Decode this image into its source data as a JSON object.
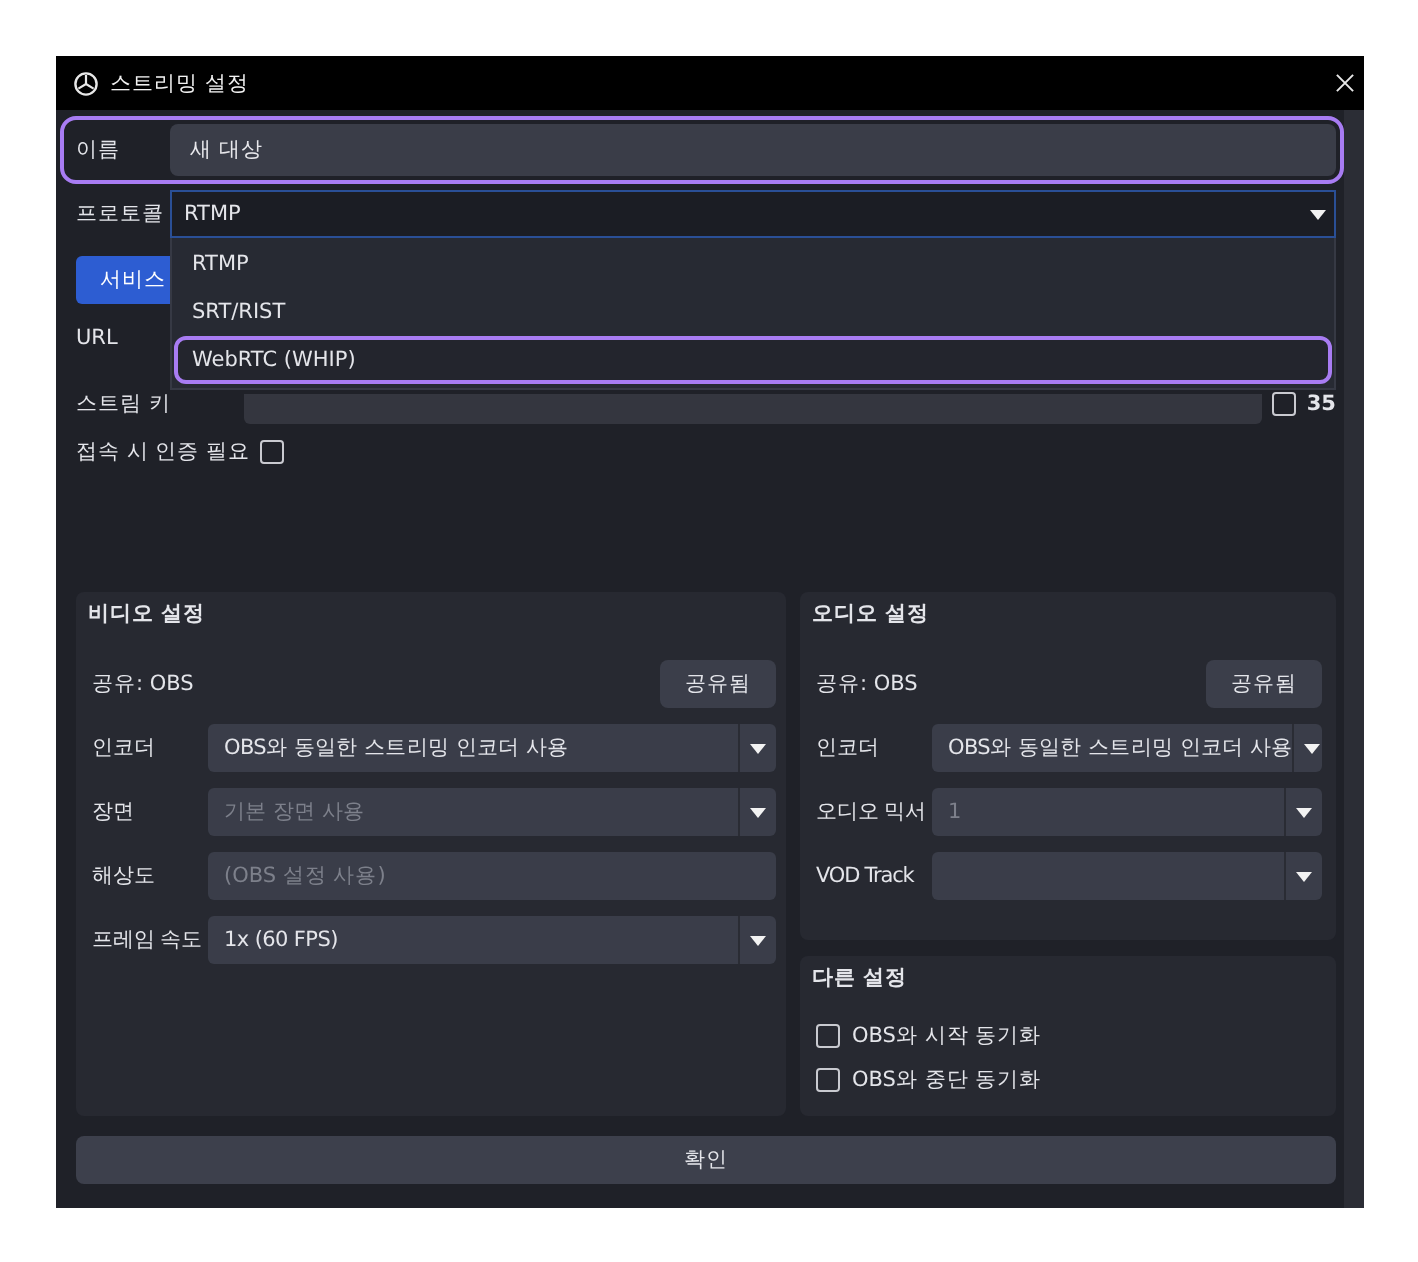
{
  "window": {
    "title": "스트리밍 설정"
  },
  "name_field": {
    "label": "이름",
    "value": "새 대상",
    "highlighted": true
  },
  "protocol": {
    "label": "프로토콜",
    "value": "RTMP",
    "expanded": true,
    "options": [
      {
        "label": "RTMP",
        "highlighted": false
      },
      {
        "label": "SRT/RIST",
        "highlighted": false
      },
      {
        "label": "WebRTC (WHIP)",
        "highlighted": true
      }
    ]
  },
  "service_button": {
    "label": "서비스"
  },
  "url": {
    "label": "URL"
  },
  "stream_key": {
    "label": "스트림 키",
    "checked": false,
    "checkbox_label": "35"
  },
  "auth": {
    "label": "접속 시 인증 필요",
    "checked": false
  },
  "video_settings": {
    "title": "비디오 설정",
    "shared_label": "공유: OBS",
    "shared_button": "공유됨",
    "fields": [
      {
        "kind": "select",
        "label": "인코더",
        "value": "OBS와 동일한 스트리밍 인코더 사용",
        "disabled": false
      },
      {
        "kind": "select",
        "label": "장면",
        "value": "기본 장면 사용",
        "disabled": true
      },
      {
        "kind": "text",
        "label": "해상도",
        "placeholder": "(OBS 설정 사용)"
      },
      {
        "kind": "select",
        "label": "프레임 속도",
        "value": "1x (60 FPS)",
        "disabled": false
      }
    ]
  },
  "audio_settings": {
    "title": "오디오 설정",
    "shared_label": "공유: OBS",
    "shared_button": "공유됨",
    "fields": [
      {
        "kind": "select",
        "label": "인코더",
        "value": "OBS와 동일한 스트리밍 인코더 사용",
        "disabled": false
      },
      {
        "kind": "select",
        "label": "오디오 믹서",
        "value": "1",
        "disabled": true
      },
      {
        "kind": "select",
        "label": "VOD Track"
      }
    ]
  },
  "other_settings": {
    "title": "다른 설정",
    "options": [
      {
        "label": "OBS와 시작 동기화",
        "checked": false
      },
      {
        "label": "OBS와 중단 동기화",
        "checked": false
      }
    ]
  },
  "confirm_button": {
    "label": "확인"
  }
}
